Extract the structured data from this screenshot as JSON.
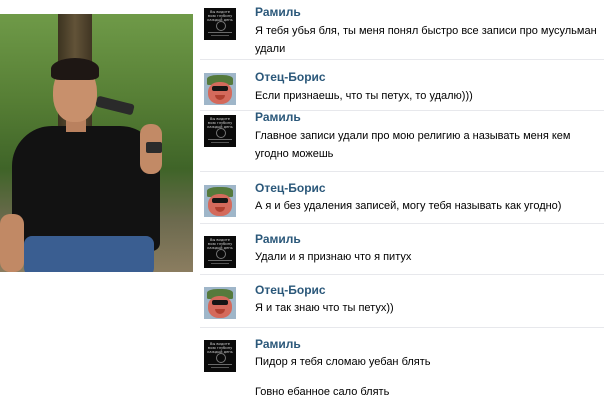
{
  "photo": {
    "description_icon": "user-photo"
  },
  "messages": [
    {
      "author": "Рамиль",
      "avatar": "ramil-avatar",
      "lines": [
        "Я тебя убья бля, ты меня понял быстро все записи про мусульман удали"
      ]
    },
    {
      "author": "Отец-Борис",
      "avatar": "boris-avatar",
      "lines": [
        "Если признаешь, что ты петух, то удалю)))"
      ]
    },
    {
      "author": "Рамиль",
      "avatar": "ramil-avatar",
      "lines": [
        "Главное записи удали про мою религию а называть меня кем угодно можешь"
      ]
    },
    {
      "author": "Отец-Борис",
      "avatar": "boris-avatar",
      "lines": [
        "А я и без удаления записей, могу тебя называть как угодно)"
      ]
    },
    {
      "author": "Рамиль",
      "avatar": "ramil-avatar",
      "lines": [
        "Удали и я признаю что я питух"
      ]
    },
    {
      "author": "Отец-Борис",
      "avatar": "boris-avatar",
      "lines": [
        "Я и так знаю что ты петух))"
      ]
    },
    {
      "author": "Рамиль",
      "avatar": "ramil-avatar",
      "lines": [
        "Пидор я тебя сломаю уебан блять",
        "Говно ебанное сало блять"
      ]
    }
  ],
  "avatar_text": {
    "ramil": "Вы видите мою глубину каждый день"
  },
  "colors": {
    "name": "#2b587a",
    "text": "#000000",
    "separator": "#e7e8ec"
  }
}
